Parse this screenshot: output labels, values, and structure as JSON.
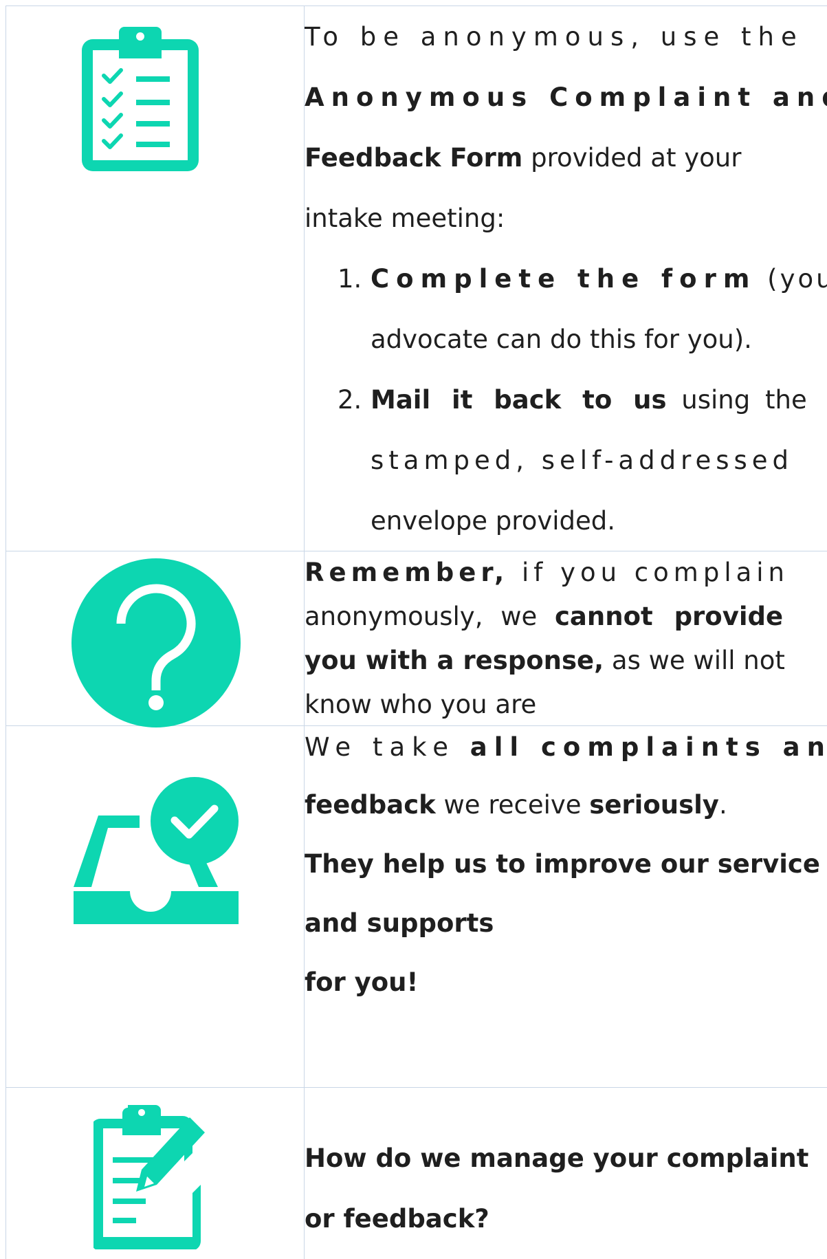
{
  "accent_color": "#0dd6b1",
  "rows": [
    {
      "icon": "clipboard-checklist-icon",
      "intro_1": "To be anonymous, use the",
      "intro_bold_1": "Anonymous Complaint and",
      "intro_bold_2": "Feedback Form",
      "intro_2": " provided at your",
      "intro_3": "intake meeting:",
      "steps": [
        {
          "number": "1.",
          "bold": "Complete the form",
          "text_1": " (your",
          "text_2": "advocate can do this for you)."
        },
        {
          "number": "2.",
          "bold": "Mail it back to us",
          "text_1": " using the",
          "text_2": "stamped, self-addressed",
          "text_3": "envelope provided."
        }
      ]
    },
    {
      "icon": "question-mark-icon",
      "bold_1": "Remember,",
      "text_1": " if you complain",
      "text_2": "anonymously, we ",
      "bold_2": "cannot provide",
      "bold_3": "you with a response,",
      "text_3": " as we will not",
      "text_4": "know who you are"
    },
    {
      "icon": "inbox-checkmark-icon",
      "text_1": "We take ",
      "bold_1": "all complaints and",
      "bold_2": "feedback",
      "text_2": " we receive ",
      "bold_3": "seriously",
      "text_3": ".",
      "bold_4": "They help us to improve our service",
      "bold_5": "and supports",
      "bold_6": "for you!"
    },
    {
      "icon": "clipboard-edit-icon",
      "bold_1": "How do we manage your complaint",
      "bold_2": "or feedback?"
    }
  ]
}
